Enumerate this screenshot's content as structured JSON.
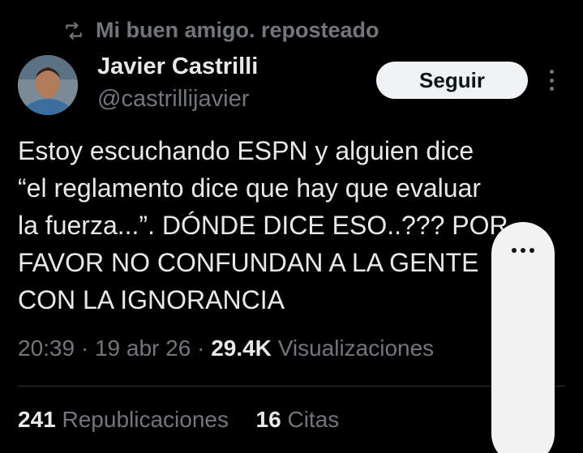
{
  "repost": {
    "text": "Mi buen amigo. reposteado",
    "icon": "repost-icon"
  },
  "author": {
    "name": "Javier Castrilli",
    "handle": "@castrillijavier"
  },
  "follow_button": "Seguir",
  "tweet": {
    "text": "Estoy escuchando ESPN y alguien dice\n“el reglamento dice que hay que evaluar\nla fuerza...”.  DÓNDE DICE ESO..??? POR\nFAVOR NO CONFUNDAN A LA GENTE\nCON LA IGNORANCIA"
  },
  "meta": {
    "time": "20:39",
    "date": "19 abr 26",
    "views_count": "29.4K",
    "views_label": "Visualizaciones"
  },
  "stats": {
    "reposts_count": "241",
    "reposts_label": "Republicaciones",
    "quotes_count": "16",
    "quotes_label": "Citas"
  },
  "colors": {
    "background": "#000000",
    "primary_text": "#e7e9ea",
    "secondary_text": "#71767b",
    "follow_bg": "#eff3f4"
  }
}
